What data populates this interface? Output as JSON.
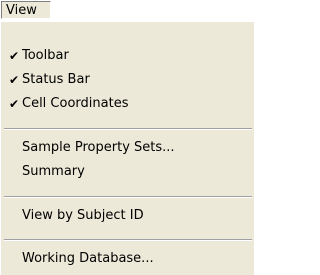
{
  "menubar": {
    "view_label": "View"
  },
  "menu": {
    "toolbar_label": "Toolbar",
    "statusbar_label": "Status Bar",
    "cellcoords_label": "Cell Coordinates",
    "sample_property_sets_label": "Sample Property Sets...",
    "summary_label": "Summary",
    "view_by_subject_label": "View by Subject ID",
    "working_database_label": "Working Database...",
    "check_glyph": "✔"
  }
}
